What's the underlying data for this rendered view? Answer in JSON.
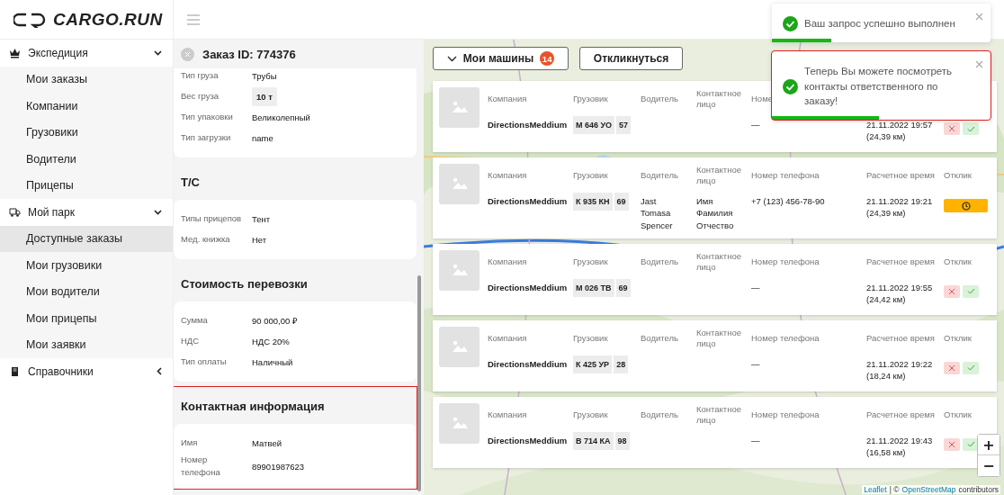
{
  "logo": {
    "text": "CARGO.RUN"
  },
  "sidebar": {
    "groups": [
      {
        "label": "Экспедиция",
        "expanded": true,
        "items": [
          {
            "label": "Мои заказы",
            "selected": false
          },
          {
            "label": "Компании",
            "selected": false
          },
          {
            "label": "Грузовики",
            "selected": false
          },
          {
            "label": "Водители",
            "selected": false
          },
          {
            "label": "Прицепы",
            "selected": false
          }
        ]
      },
      {
        "label": "Мой парк",
        "expanded": true,
        "items": [
          {
            "label": "Доступные заказы",
            "selected": true
          },
          {
            "label": "Мои грузовики",
            "selected": false
          },
          {
            "label": "Мои водители",
            "selected": false
          },
          {
            "label": "Мои прицепы",
            "selected": false
          },
          {
            "label": "Мои заявки",
            "selected": false
          }
        ]
      },
      {
        "label": "Справочники",
        "expanded": false
      }
    ]
  },
  "order": {
    "title": "Заказ ID: 774376",
    "sections": [
      {
        "highlighted": false,
        "rows": [
          {
            "label": "Тип груза",
            "value": "Трубы",
            "kind": "plain"
          },
          {
            "label": "Вес груза",
            "value": "10 т",
            "kind": "chip"
          },
          {
            "label": "Тип упаковки",
            "value": "Великолепный",
            "kind": "plain"
          },
          {
            "label": "Тип загрузки",
            "value": "name",
            "kind": "plain"
          }
        ]
      },
      {
        "title": "Т/С",
        "highlighted": false,
        "rows": [
          {
            "label": "Типы прицепов",
            "value": "Тент",
            "kind": "plain"
          },
          {
            "label": "Мед. книжка",
            "value": "Нет",
            "kind": "plain"
          }
        ]
      },
      {
        "title": "Стоимость перевозки",
        "highlighted": false,
        "rows": [
          {
            "label": "Сумма",
            "value": "90 000,00 ₽",
            "kind": "plain"
          },
          {
            "label": "НДС",
            "value": "НДС 20%",
            "kind": "plain"
          },
          {
            "label": "Тип оплаты",
            "value": "Наличный",
            "kind": "plain"
          }
        ]
      },
      {
        "title": "Контактная информация",
        "highlighted": true,
        "rows": [
          {
            "label": "Имя",
            "value": "Матвей",
            "kind": "plain"
          },
          {
            "label": "Номер телефона",
            "value": "89901987623",
            "kind": "plain"
          }
        ]
      }
    ]
  },
  "map": {
    "buttons": [
      {
        "label": "Мои машины",
        "badge": "14",
        "kind": "dropdown"
      },
      {
        "label": "Откликнуться",
        "kind": "plain"
      }
    ],
    "cards": [
      {
        "headers": [
          "Компания",
          "Грузовик",
          "Водитель",
          "Контактное лицо",
          "Номе"
        ],
        "company": "DirectionsMeddium",
        "plate": "М 646 УО",
        "region": "57",
        "phone": "—",
        "time": "21.11.2022 19:57",
        "distance": "(24,39 км)",
        "kind": "decide"
      },
      {
        "headers": [
          "Компания",
          "Грузовик",
          "Водитель",
          "Контактное лицо",
          "Номер телефона",
          "Расчетное время",
          "Отклик"
        ],
        "company": "DirectionsMeddium",
        "plate": "К 935 КН",
        "region": "69",
        "driver": "Jast Tomasa Spencer",
        "contact": "Имя Фамилия Отчество",
        "phone": "+7 (123) 456-78-90",
        "time": "21.11.2022 19:21",
        "distance": "(24,39 км)",
        "kind": "pending"
      },
      {
        "headers": [
          "Компания",
          "Грузовик",
          "Водитель",
          "Контактное лицо",
          "Номер телефона",
          "Расчетное время",
          "Отклик"
        ],
        "company": "DirectionsMeddium",
        "plate": "М 026 ТВ",
        "region": "69",
        "phone": "—",
        "time": "21.11.2022 19:55",
        "distance": "(24,42 км)",
        "kind": "decide"
      },
      {
        "headers": [
          "Компания",
          "Грузовик",
          "Водитель",
          "Контактное лицо",
          "Номер телефона",
          "Расчетное время",
          "Отклик"
        ],
        "company": "DirectionsMeddium",
        "plate": "К 425 УР",
        "region": "28",
        "phone": "—",
        "time": "21.11.2022 19:22",
        "distance": "(18,24 км)",
        "kind": "decide"
      },
      {
        "headers": [
          "Компания",
          "Грузовик",
          "Водитель",
          "Контактное лицо",
          "Номер телефона",
          "Расчетное время",
          "Отклик"
        ],
        "company": "DirectionsMeddium",
        "plate": "В 714 КА",
        "region": "98",
        "phone": "—",
        "time": "21.11.2022 19:43",
        "distance": "(16,58 км)",
        "kind": "decide"
      }
    ],
    "zoom": {
      "in": "+",
      "out": "−"
    },
    "attribution": {
      "link1": "Leaflet",
      "sep": "| ©",
      "link2": "OpenStreetMap",
      "tail": "contributors"
    }
  },
  "toasts": [
    {
      "text": "Ваш запрос успешно выполнен",
      "level": 0.27,
      "highlighted": false
    },
    {
      "text": "Теперь Вы можете посмотреть контакты ответственного по заказу!",
      "level": 0.49,
      "highlighted": true
    }
  ]
}
